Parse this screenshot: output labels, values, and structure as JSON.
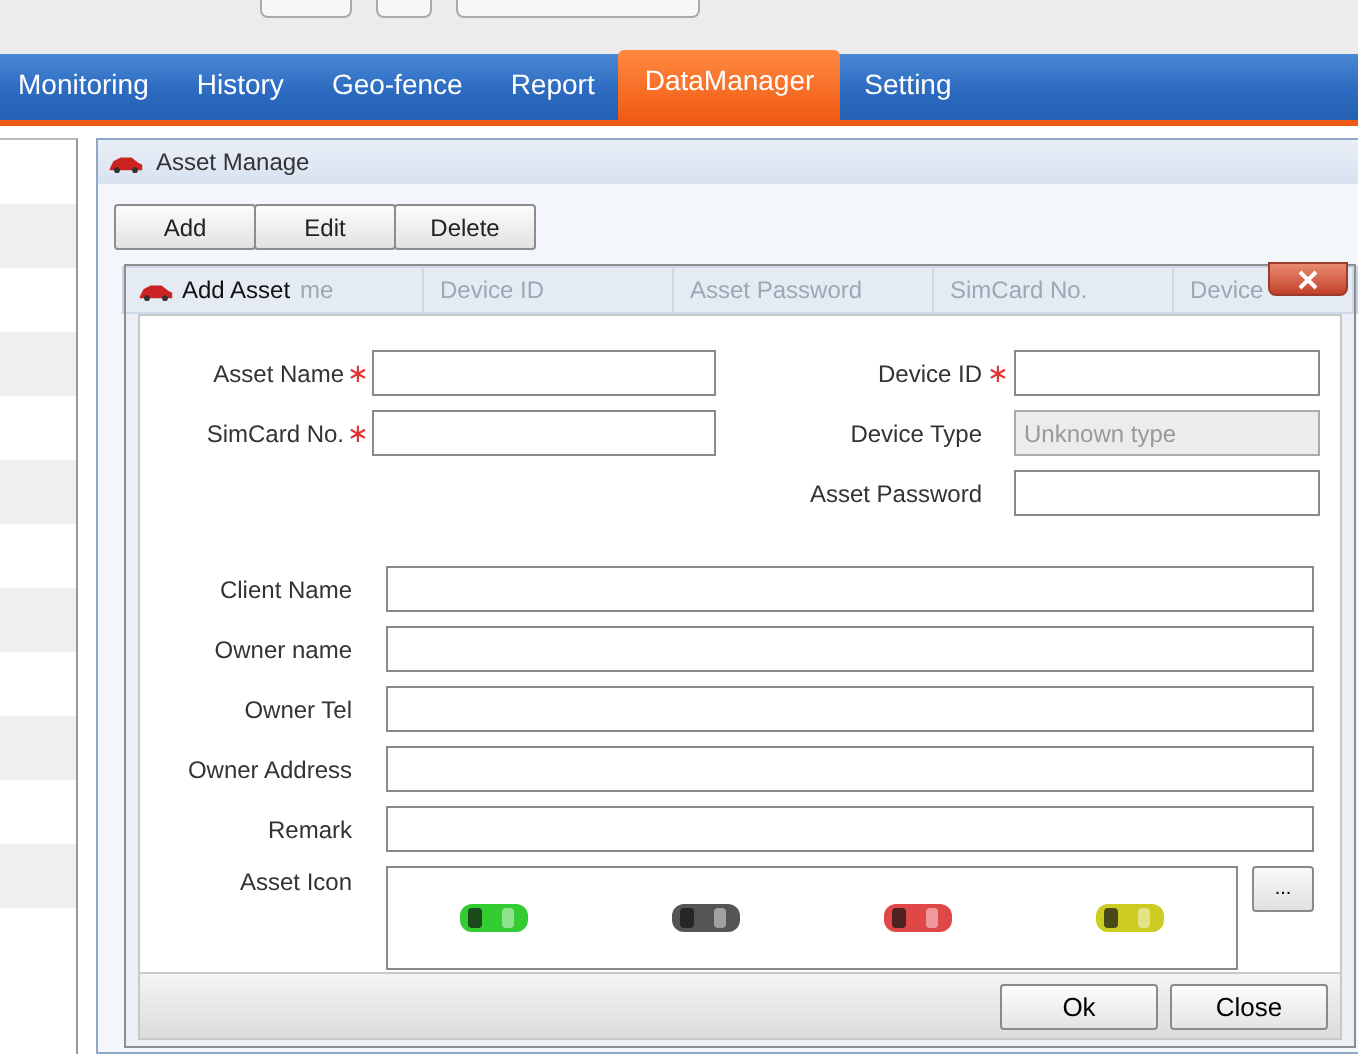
{
  "nav": {
    "tabs": [
      {
        "label": "Monitoring",
        "selected": false
      },
      {
        "label": "History",
        "selected": false
      },
      {
        "label": "Geo-fence",
        "selected": false
      },
      {
        "label": "Report",
        "selected": false
      },
      {
        "label": "DataManager",
        "selected": true
      },
      {
        "label": "Setting",
        "selected": false
      }
    ]
  },
  "panel": {
    "title": "Asset Manage",
    "toolbar": [
      "Add",
      "Edit",
      "Delete"
    ],
    "table": {
      "columns": [
        "me",
        "Device ID",
        "Asset Password",
        "SimCard No.",
        "Device"
      ]
    }
  },
  "dialog": {
    "title": "Add Asset",
    "required_mark": "∗",
    "left_fields": [
      {
        "label": "Asset Name",
        "required": true,
        "disabled": false
      },
      {
        "label": "SimCard No.",
        "required": true,
        "disabled": false
      }
    ],
    "right_fields": [
      {
        "label": "Device ID",
        "required": true,
        "disabled": false
      },
      {
        "label": "Device Type",
        "required": false,
        "disabled": true,
        "value": "Unknown type"
      },
      {
        "label": "Asset Password",
        "required": false,
        "disabled": false
      }
    ],
    "wide_fields": [
      {
        "label": "Client Name"
      },
      {
        "label": "Owner name"
      },
      {
        "label": "Owner Tel"
      },
      {
        "label": "Owner Address"
      },
      {
        "label": "Remark"
      }
    ],
    "asset_icon": {
      "label": "Asset Icon",
      "browse": "...",
      "icons": [
        {
          "color": "#33cc33"
        },
        {
          "color": "#555555"
        },
        {
          "color": "#e04848"
        },
        {
          "color": "#cccc22"
        }
      ]
    },
    "buttons": [
      "Ok",
      "Close"
    ]
  }
}
